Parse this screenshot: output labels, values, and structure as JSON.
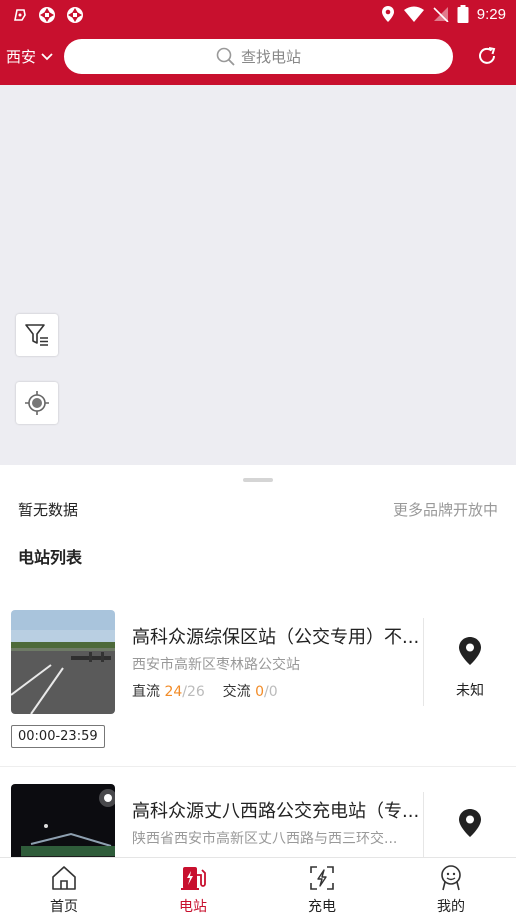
{
  "status_bar": {
    "time": "9:29"
  },
  "header": {
    "city": "西安",
    "search_placeholder": "查找电站"
  },
  "sheet": {
    "no_data": "暂无数据",
    "more_brands": "更多品牌开放中",
    "list_title": "电站列表"
  },
  "stations": [
    {
      "name": "高科众源综保区站（公交专用）不...",
      "address": "西安市高新区枣林路公交站",
      "dc_label": "直流",
      "dc_available": "24",
      "dc_total": "/26",
      "ac_label": "交流",
      "ac_available": "0",
      "ac_total": "/0",
      "status": "未知",
      "hours": "00:00-23:59"
    },
    {
      "name": "高科众源丈八西路公交充电站（专...",
      "address": "陕西省西安市高新区丈八西路与西三环交..."
    }
  ],
  "nav": {
    "items": [
      {
        "label": "首页",
        "icon": "home-icon",
        "active": false
      },
      {
        "label": "电站",
        "icon": "charging-station-icon",
        "active": true
      },
      {
        "label": "充电",
        "icon": "scan-charge-icon",
        "active": false
      },
      {
        "label": "我的",
        "icon": "profile-icon",
        "active": false
      }
    ]
  },
  "colors": {
    "brand": "#c8102e",
    "accent_orange": "#f28c28",
    "map_bg": "#ededf2"
  }
}
